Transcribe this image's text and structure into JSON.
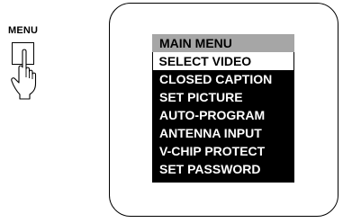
{
  "remote": {
    "button_label": "MENU"
  },
  "menu": {
    "title": "MAIN MENU",
    "selected_index": 0,
    "items": [
      "SELECT VIDEO",
      "CLOSED CAPTION",
      "SET PICTURE",
      "AUTO-PROGRAM",
      "ANTENNA INPUT",
      "V-CHIP PROTECT",
      "SET PASSWORD"
    ]
  },
  "colors": {
    "title_bar": "#a6a6a6",
    "item_background": "#000000",
    "item_text": "#ffffff",
    "selected_background": "#ffffff",
    "selected_text": "#000000"
  }
}
